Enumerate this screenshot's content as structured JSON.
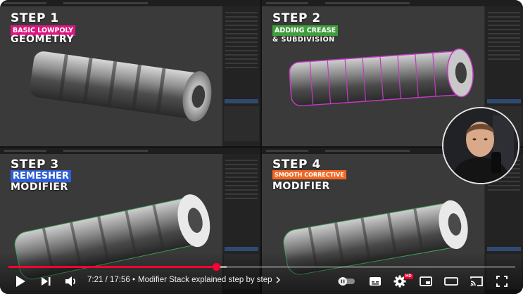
{
  "quadrants": [
    {
      "step": "STEP 1",
      "tag": "BASIC LOWPOLY",
      "tag_color": "#d8187e",
      "subtitle": "GEOMETRY"
    },
    {
      "step": "STEP 2",
      "tag": "ADDING CREASE",
      "tag_color": "#3f9d3c",
      "subtitle": "& SUBDIVISION"
    },
    {
      "step": "STEP 3",
      "tag": "REMESHER",
      "tag_color": "#2f5fd6",
      "subtitle": "MODIFIER"
    },
    {
      "step": "STEP 4",
      "tag": "SMOOTH CORRECTIVE",
      "tag_color": "#f26722",
      "subtitle": "MODIFIER"
    }
  ],
  "player": {
    "current_time": "7:21",
    "duration": "17:56",
    "time_display": "7:21 / 17:56",
    "chapter_separator": "•",
    "chapter_title": "Modifier Stack explained step by step",
    "progress_fraction": 0.41,
    "buffered_fraction": 0.43,
    "hd_badge": "HD",
    "accent_color": "#ff0033"
  },
  "controls": {
    "play_icon": "play-icon",
    "next_icon": "next-icon",
    "volume_icon": "volume-icon",
    "autoplay_icon": "autoplay-toggle-icon",
    "subtitles_icon": "subtitles-icon",
    "settings_icon": "gear-icon",
    "miniplayer_icon": "miniplayer-icon",
    "theater_icon": "theater-mode-icon",
    "cast_icon": "cast-icon",
    "fullscreen_icon": "fullscreen-icon"
  }
}
